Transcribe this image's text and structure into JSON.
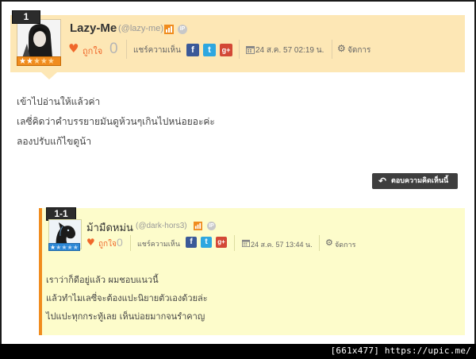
{
  "comment": {
    "number": "1",
    "username": "Lazy-Me",
    "handle": "(@lazy-me)",
    "like_label": "ถูกใจ",
    "like_count": "0",
    "share_label": "แชร์ความเห็น",
    "date": "24 ส.ค. 57 02:19 น.",
    "manage_label": "จัดการ",
    "stars_total": 5,
    "stars_filled": 2,
    "lines": [
      "เข้าไปอ่านให้แล้วค่า",
      "เลซี่คิดว่าคำบรรยายมันดูห้วนๆเกินไปหน่อยอะค่ะ",
      "ลองปรับแก้ไขดูน้า"
    ],
    "reply_button": "ตอบความคิดเห็นนี้"
  },
  "reply": {
    "number": "1-1",
    "username": "ม้ามืดหม่น",
    "handle": "(@dark-hors3)",
    "like_label": "ถูกใจ",
    "like_count": "0",
    "share_label": "แชร์ความเห็น",
    "date": "24 ส.ค. 57 13:44 น.",
    "manage_label": "จัดการ",
    "stars_total": 5,
    "stars_filled": 1,
    "lines": [
      "เราว่าก็ดีอยู่แล้ว ผมชอบแนวนี้",
      "แล้วทำไมเลซี่จะต้องแปะนิยายตัวเองด้วยล่ะ",
      "ไปแปะทุกกระทู้เลย เห็นบ่อยมากจนรำคาญ"
    ]
  },
  "social": {
    "facebook": "f",
    "twitter": "t",
    "googleplus": "g+"
  },
  "ip_badge": "IP",
  "watermark": "[661x477] https://upic.me/",
  "colors": {
    "header_bg": "#fde7b5",
    "reply_bg": "#fdfccb",
    "accent": "#f08c1e",
    "heart": "#f0672a",
    "facebook": "#3b5998",
    "twitter": "#2ea7e0",
    "googleplus": "#d34836"
  }
}
